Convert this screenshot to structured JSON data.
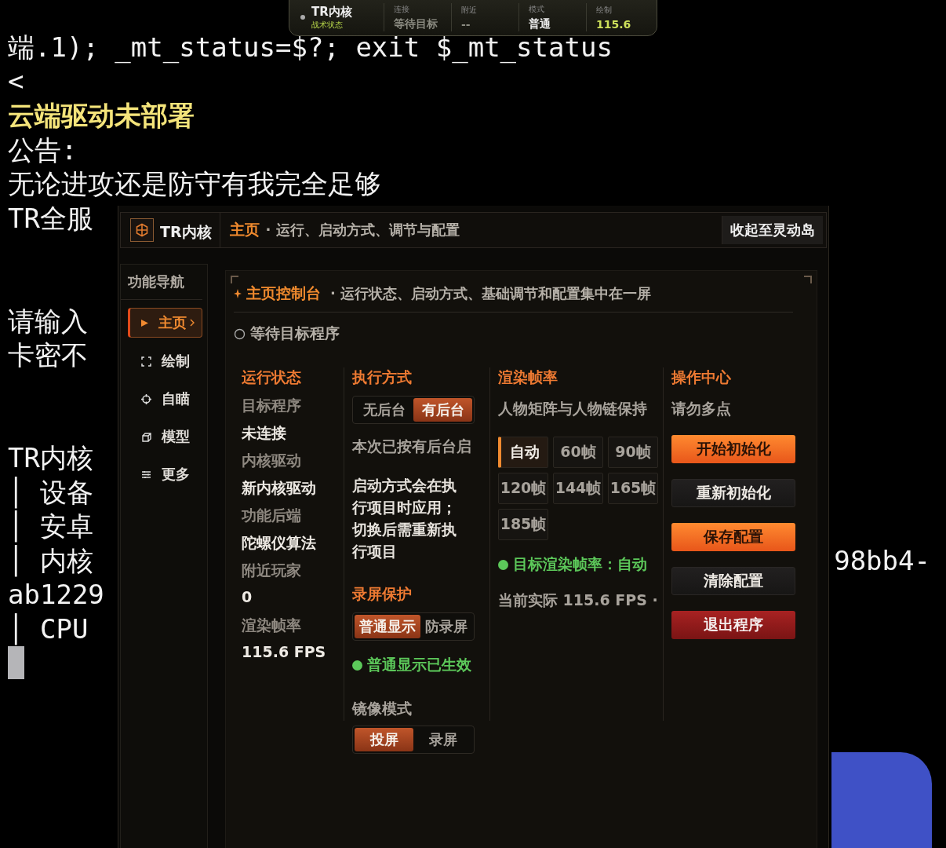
{
  "terminal": {
    "lines": [
      {
        "kind": "plain",
        "text": "端.1); _mt_status=$?; exit $_mt_status"
      },
      {
        "kind": "plain",
        "text": "<"
      },
      {
        "kind": "highlight",
        "text": "云端驱动未部署"
      },
      {
        "kind": "plain",
        "text": "公告:"
      },
      {
        "kind": "plain",
        "text": "无论进攻还是防守有我完全足够"
      },
      {
        "kind": "plain",
        "text": "TR全服"
      },
      {
        "kind": "blank"
      },
      {
        "kind": "blank"
      },
      {
        "kind": "plain",
        "text": "请输入"
      },
      {
        "kind": "plain",
        "text": "卡密不"
      },
      {
        "kind": "blank"
      },
      {
        "kind": "blank"
      },
      {
        "kind": "plain",
        "text": "TR内核"
      },
      {
        "kind": "plain",
        "text": "│ 设备"
      },
      {
        "kind": "plain",
        "text": "│ 安卓"
      },
      {
        "kind": "plain",
        "text": "│ 内核",
        "right": "98bb4-"
      },
      {
        "kind": "plain",
        "text": "ab1229"
      },
      {
        "kind": "plain",
        "text": "│ CPU"
      },
      {
        "kind": "cursor"
      }
    ]
  },
  "island": {
    "title": "TR内核",
    "subtitle": "战术状态",
    "stats": [
      {
        "label": "连接",
        "value": "等待目标",
        "kind": "muted"
      },
      {
        "label": "附近",
        "value": "--",
        "kind": "muted"
      },
      {
        "label": "模式",
        "value": "普通",
        "kind": "normal"
      },
      {
        "label": "绘制",
        "value": "115.6",
        "kind": "accent"
      }
    ]
  },
  "panel": {
    "brand": "TR内核",
    "page": "主页",
    "subtitle": "· 运行、启动方式、调节与配置",
    "collapse_button": "收起至灵动岛",
    "nav_title": "功能导航",
    "nav": [
      {
        "label": "主页",
        "selected": true
      },
      {
        "label": "绘制",
        "selected": false
      },
      {
        "label": "自瞄",
        "selected": false
      },
      {
        "label": "模型",
        "selected": false
      },
      {
        "label": "更多",
        "selected": false
      }
    ],
    "console": {
      "title": "主页控制台",
      "subtitle": "· 运行状态、启动方式、基础调节和配置集中在一屏",
      "status": "等待目标程序",
      "columns": [
        {
          "blocks": [
            {
              "kind": "heading",
              "text": "运行状态"
            },
            {
              "kind": "label",
              "text": "目标程序"
            },
            {
              "kind": "value",
              "text": "未连接"
            },
            {
              "kind": "label",
              "text": "内核驱动"
            },
            {
              "kind": "value",
              "text": "新内核驱动"
            },
            {
              "kind": "label",
              "text": "功能后端"
            },
            {
              "kind": "value",
              "text": "陀螺仪算法"
            },
            {
              "kind": "label",
              "text": "附近玩家"
            },
            {
              "kind": "value",
              "text": "0"
            },
            {
              "kind": "label",
              "text": "渲染帧率"
            },
            {
              "kind": "value",
              "text": "115.6 FPS"
            }
          ]
        },
        {
          "blocks": [
            {
              "kind": "heading",
              "text": "执行方式"
            },
            {
              "kind": "segmented",
              "options": [
                {
                  "label": "无后台",
                  "selected": false
                },
                {
                  "label": "有后台",
                  "selected": true
                }
              ]
            },
            {
              "kind": "note",
              "text": "本次已按有后台启"
            },
            {
              "kind": "info",
              "text": "启动方式会在执行项目时应用；切换后需重新执行项目"
            },
            {
              "kind": "heading",
              "text": "录屏保护"
            },
            {
              "kind": "segmented",
              "options": [
                {
                  "label": "普通显示",
                  "selected": true
                },
                {
                  "label": "防录屏",
                  "selected": false
                }
              ]
            },
            {
              "kind": "status",
              "text": "普通显示已生效"
            },
            {
              "kind": "subheading",
              "text": "镜像模式"
            },
            {
              "kind": "segmented",
              "options": [
                {
                  "label": "投屏",
                  "selected": true
                },
                {
                  "label": "录屏",
                  "selected": false
                }
              ]
            }
          ]
        },
        {
          "blocks": [
            {
              "kind": "heading",
              "text": "渲染帧率"
            },
            {
              "kind": "note",
              "text": "人物矩阵与人物链保持"
            },
            {
              "kind": "options",
              "options": [
                {
                  "label": "自动",
                  "selected": true
                },
                {
                  "label": "60帧",
                  "selected": false
                },
                {
                  "label": "90帧",
                  "selected": false
                },
                {
                  "label": "120帧",
                  "selected": false
                },
                {
                  "label": "144帧",
                  "selected": false
                },
                {
                  "label": "165帧",
                  "selected": false
                },
                {
                  "label": "185帧",
                  "selected": false
                }
              ]
            },
            {
              "kind": "status",
              "text": "目标渲染帧率：自动"
            },
            {
              "kind": "note",
              "text": "当前实际 115.6 FPS ·"
            }
          ]
        },
        {
          "blocks": [
            {
              "kind": "heading",
              "text": "操作中心"
            },
            {
              "kind": "note",
              "text": "请勿多点"
            },
            {
              "kind": "primary",
              "text": "开始初始化"
            },
            {
              "kind": "secondary",
              "text": "重新初始化"
            },
            {
              "kind": "primary",
              "text": "保存配置"
            },
            {
              "kind": "secondary",
              "text": "清除配置"
            },
            {
              "kind": "danger",
              "text": "退出程序"
            }
          ]
        }
      ]
    }
  }
}
